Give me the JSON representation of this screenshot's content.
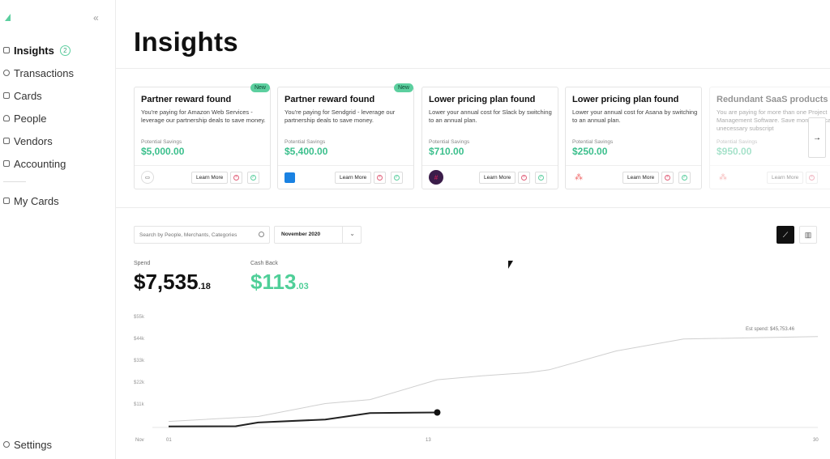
{
  "sidebar": {
    "collapse_glyph": "«",
    "items": [
      {
        "label": "Insights",
        "badge": "2"
      },
      {
        "label": "Transactions"
      },
      {
        "label": "Cards"
      },
      {
        "label": "People"
      },
      {
        "label": "Vendors"
      },
      {
        "label": "Accounting"
      },
      {
        "label": "My Cards"
      }
    ],
    "settings_label": "Settings"
  },
  "header": {
    "title": "Insights"
  },
  "insights_cards": [
    {
      "badge": "New",
      "title": "Partner reward found",
      "description": "You're paying for Amazon Web Services - leverage our partnership deals to save money.",
      "savings_label": "Potential Savings",
      "savings": "$5,000.00",
      "learn_more": "Learn More",
      "logo_icon": "aws-logo-icon"
    },
    {
      "badge": "New",
      "title": "Partner reward found",
      "description": "You're paying for Sendgrid - leverage our partnership deals to save money.",
      "savings_label": "Potential Savings",
      "savings": "$5,400.00",
      "learn_more": "Learn More",
      "logo_icon": "sendgrid-logo-icon"
    },
    {
      "title": "Lower pricing plan found",
      "description": "Lower your annual cost for Slack by switching to an annual plan.",
      "savings_label": "Potential Savings",
      "savings": "$710.00",
      "learn_more": "Learn More",
      "logo_icon": "slack-logo-icon"
    },
    {
      "title": "Lower pricing plan found",
      "description": "Lower your annual cost for Asana by switching to an annual plan.",
      "savings_label": "Potential Savings",
      "savings": "$250.00",
      "learn_more": "Learn More",
      "logo_icon": "asana-logo-icon"
    },
    {
      "title": "Redundant SaaS products",
      "description": "You are paying for more than one Project Management Software. Save money by canceling unecessary subscript",
      "savings_label": "Potential Savings",
      "savings": "$950.00",
      "learn_more": "Learn More",
      "logo_icon": "saas-logos-icon"
    }
  ],
  "filters": {
    "search_placeholder": "Search by People, Merchants, Categories",
    "month": "November 2020"
  },
  "stats": {
    "spend_label": "Spend",
    "spend_main": "$7,535",
    "spend_cents": ".18",
    "cashback_label": "Cash Back",
    "cashback_main": "$113",
    "cashback_cents": ".03"
  },
  "colors": {
    "accent": "#5ccf9f",
    "cashback": "#4fcf98",
    "dismiss": "#e0617a"
  },
  "chart_data": {
    "type": "line",
    "x_month_label": "Nov",
    "x_tick_labels": [
      "01",
      "13",
      "30"
    ],
    "y_tick_labels": [
      "$55k",
      "$44k",
      "$33k",
      "$22k",
      "$11k"
    ],
    "ylim": [
      0,
      55000
    ],
    "xlim": [
      1,
      30
    ],
    "annotation": "Est spend: $45,753.46",
    "series": [
      {
        "role": "estimate",
        "color": "#cfcfcf",
        "x": [
          1,
          5,
          8,
          10,
          13,
          15,
          17,
          18,
          21,
          24,
          30
        ],
        "y": [
          3000,
          5500,
          12000,
          14000,
          24000,
          26000,
          27500,
          29000,
          38500,
          44500,
          45753
        ]
      },
      {
        "role": "actual",
        "color": "#222222",
        "x": [
          1,
          4,
          5,
          8,
          10,
          13
        ],
        "y": [
          500,
          600,
          2500,
          4000,
          7200,
          7535
        ]
      }
    ]
  }
}
